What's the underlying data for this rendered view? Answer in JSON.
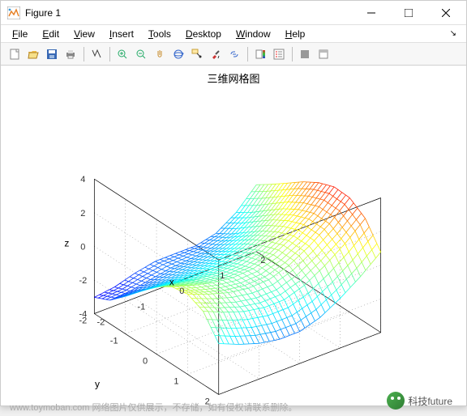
{
  "window": {
    "title": "Figure 1"
  },
  "menu": [
    "File",
    "Edit",
    "View",
    "Insert",
    "Tools",
    "Desktop",
    "Window",
    "Help"
  ],
  "toolbar": {
    "new": "new-icon",
    "open": "open-icon",
    "save": "save-icon",
    "print": "print-icon",
    "edit": "edit-icon",
    "zoomin": "zoom-in-icon",
    "zoomout": "zoom-out-icon",
    "pan": "pan-icon",
    "rotate": "rotate-3d-icon",
    "datacursor": "data-cursor-icon",
    "brush": "brush-icon",
    "link": "link-icon",
    "colorbar": "colorbar-icon",
    "legend": "legend-icon",
    "hide": "hide-plot-icon",
    "show": "show-plot-icon"
  },
  "chart_data": {
    "type": "surface-mesh-3d",
    "title": "三维网格图",
    "xlabel": "x",
    "ylabel": "y",
    "zlabel": "z",
    "xlim": [
      -2,
      2
    ],
    "ylim": [
      -2,
      2
    ],
    "zlim": [
      -4,
      4
    ],
    "xticks": [
      -2,
      -1,
      0,
      1,
      2
    ],
    "yticks": [
      -2,
      -1,
      0,
      1,
      2
    ],
    "zticks": [
      -4,
      -2,
      0,
      2,
      4
    ],
    "grid": true,
    "colormap": "jet (z-mapped)",
    "x": [
      -2,
      -1.5,
      -1,
      -0.5,
      0,
      0.5,
      1,
      1.5,
      2
    ],
    "y": [
      -2,
      -1.5,
      -1,
      -0.5,
      0,
      0.5,
      1,
      1.5,
      2
    ],
    "z_rows_over_y": [
      [
        -3.03,
        -2.88,
        -2.52,
        -2.28,
        -2.27,
        -2.28,
        -2.0,
        -1.22,
        -0.03
      ],
      [
        -2.6,
        -2.52,
        -2.3,
        -2.07,
        -1.97,
        -1.82,
        -1.43,
        -0.61,
        0.6
      ],
      [
        -1.77,
        -1.8,
        -1.73,
        -1.6,
        -1.47,
        -1.23,
        -0.73,
        0.11,
        1.27
      ],
      [
        -0.85,
        -0.99,
        -1.09,
        -1.06,
        -0.94,
        -0.62,
        -0.05,
        0.81,
        1.95
      ],
      [
        0.0,
        -0.26,
        -0.49,
        -0.57,
        -0.47,
        -0.13,
        0.49,
        1.37,
        2.5
      ],
      [
        0.6,
        0.22,
        -0.08,
        -0.24,
        -0.17,
        0.2,
        0.86,
        1.74,
        2.85
      ],
      [
        0.77,
        0.3,
        -0.07,
        -0.27,
        -0.23,
        0.17,
        0.85,
        1.72,
        2.8
      ],
      [
        0.35,
        -0.17,
        -0.59,
        -0.82,
        -0.81,
        -0.41,
        0.29,
        1.14,
        2.18
      ],
      [
        -0.97,
        -1.48,
        -1.88,
        -2.1,
        -2.1,
        -1.73,
        -1.04,
        -0.21,
        0.78
      ]
    ]
  },
  "watermark": "www.toymoban.com 网络图片仅供展示，不存储，如有侵权请联系删除。",
  "badge": "科技future"
}
